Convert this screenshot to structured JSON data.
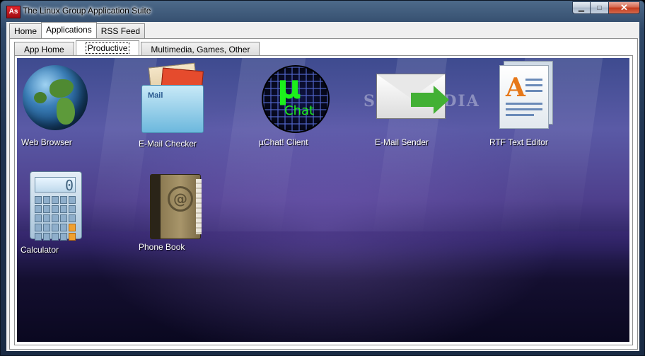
{
  "window": {
    "app_icon_text": "As",
    "title": "The Linux Group Application Suite",
    "minimize_glyph": "▁",
    "maximize_glyph": "□",
    "close_glyph": "✕"
  },
  "main_tabs": [
    "Home",
    "Applications",
    "RSS Feed"
  ],
  "main_tabs_active": "Applications",
  "sub_tabs": [
    "App Home",
    "Productive",
    "Multimedia, Games, Other"
  ],
  "sub_tabs_active": "Productive",
  "watermark": "SOFTPEDIA",
  "apps": [
    {
      "label": "Web Browser",
      "icon": "globe-icon"
    },
    {
      "label": "E-Mail Checker",
      "icon": "mailbox-icon"
    },
    {
      "label": "µChat! Client",
      "icon": "chat-icon",
      "icon_text_1": "µ",
      "icon_text_2": "Chat"
    },
    {
      "label": "E-Mail Sender",
      "icon": "envelope-arrow-icon"
    },
    {
      "label": "RTF Text Editor",
      "icon": "document-icon",
      "icon_text": "A"
    },
    {
      "label": "Calculator",
      "icon": "calculator-icon",
      "icon_text": "0"
    },
    {
      "label": "Phone Book",
      "icon": "address-book-icon",
      "icon_text": "@"
    }
  ],
  "mailbox_icon_text": "Mail",
  "colors": {
    "chat_green": "#1cf01c",
    "close_red": "#c4391b",
    "desktop_purple": "#4e3f8c"
  }
}
